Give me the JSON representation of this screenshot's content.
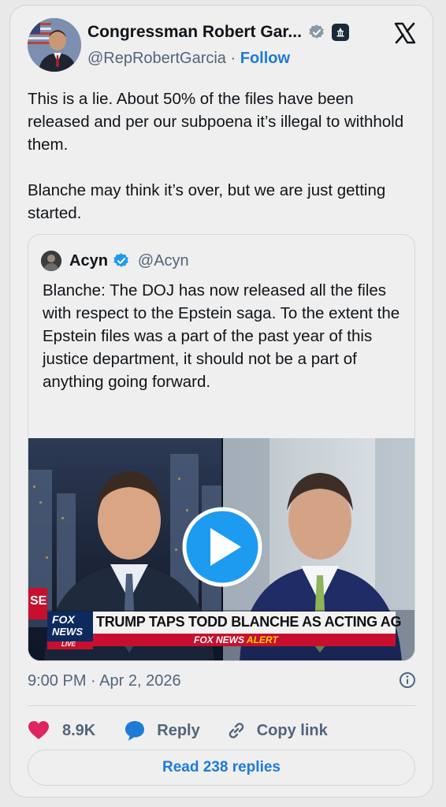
{
  "author": {
    "name": "Congressman Robert Gar...",
    "handle": "@RepRobertGarcia",
    "separator": "·",
    "follow_label": "Follow"
  },
  "tweet": {
    "paragraphs": [
      "This is a lie. About 50% of the files have been released and per our subpoena it’s illegal to withhold them.",
      "Blanche may think it’s over, but we are just getting started."
    ],
    "timestamp": "9:00 PM · Apr 2, 2026"
  },
  "quote": {
    "name": "Acyn",
    "handle": "@Acyn",
    "text": "Blanche: The DOJ has now released all the files with respect to the Epstein saga. To the extent the Epstein files was a part of the past year of this justice department, it should not be a part of anything going forward.",
    "video": {
      "chyron": "TRUMP TAPS TODD BLANCHE AS ACTING AG",
      "network_top": "FOX",
      "network_bottom": "NEWS",
      "live": "LIVE",
      "alert_prefix": "FOX NEWS",
      "alert_word": "ALERT",
      "edge_text": "SE"
    }
  },
  "actions": {
    "likes": "8.9K",
    "reply_label": "Reply",
    "copy_label": "Copy link"
  },
  "read_replies_label": "Read 238 replies",
  "colors": {
    "accent": "#1d7bd8",
    "like": "#e0245e",
    "muted": "#53647a",
    "chyron_red": "#c8102e"
  },
  "icons": [
    "verified-gray-icon",
    "government-badge-icon",
    "x-logo-icon",
    "verified-blue-icon",
    "play-icon",
    "info-icon",
    "heart-icon",
    "reply-bubble-icon",
    "link-icon"
  ]
}
